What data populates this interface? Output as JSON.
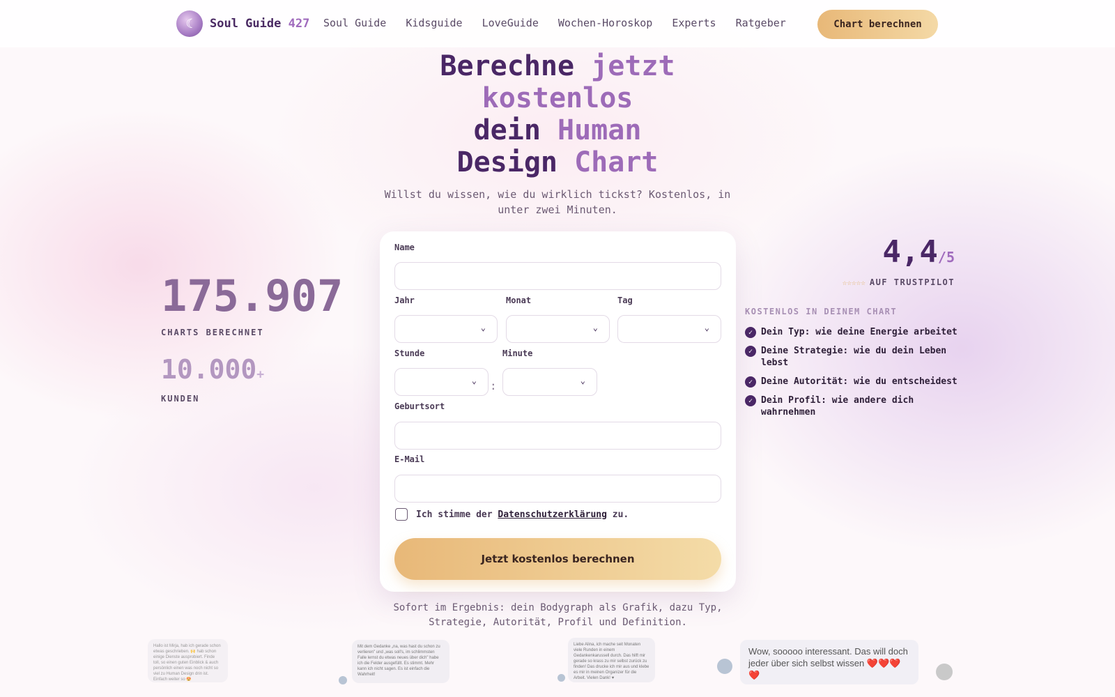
{
  "header": {
    "brand_name": "Soul Guide",
    "brand_number": "427",
    "logo_icon": "moon-face-icon",
    "nav": [
      {
        "label": "Soul Guide"
      },
      {
        "label": "Kidsguide"
      },
      {
        "label": "LoveGuide"
      },
      {
        "label": "Wochen-Horoskop"
      },
      {
        "label": "Experts"
      },
      {
        "label": "Ratgeber"
      }
    ],
    "cta_label": "Chart berechnen"
  },
  "hero": {
    "title_line1_a": "Berechne ",
    "title_line1_b": "jetzt",
    "title_line2": "kostenlos",
    "title_line3_a": "dein ",
    "title_line3_b": "Human",
    "title_line4_a": "Design ",
    "title_line4_b": "Chart",
    "subtitle": "Willst du wissen, wie du wirklich tickst? Kostenlos, in unter zwei Minuten."
  },
  "stats": {
    "charts_value": "175.907",
    "charts_label": "CHARTS BERECHNET",
    "customers_value": "10.000",
    "customers_plus": "+",
    "customers_label": "KUNDEN"
  },
  "rating": {
    "value": "4,4",
    "out_of": "/5",
    "stars": "☆☆☆☆☆",
    "source_label": "AUF TRUSTPILOT"
  },
  "features": {
    "label": "KOSTENLOS IN DEINEM CHART",
    "items": [
      "Dein Typ: wie deine Energie arbeitet",
      "Deine Strategie: wie du dein Leben lebst",
      "Deine Autorität: wie du entscheidest",
      "Dein Profil: wie andere dich wahrnehmen"
    ]
  },
  "form": {
    "name_label": "Name",
    "name_value": "",
    "year_label": "Jahr",
    "month_label": "Monat",
    "day_label": "Tag",
    "hour_label": "Stunde",
    "minute_label": "Minute",
    "time_separator": ":",
    "birthplace_label": "Geburtsort",
    "birthplace_value": "",
    "email_label": "E-Mail",
    "email_value": "",
    "consent_prefix": "Ich stimme der ",
    "consent_link": "Datenschutzerklärung",
    "consent_suffix": " zu.",
    "consent_checked": false,
    "submit_label": "Jetzt kostenlos berechnen"
  },
  "result_note": "Sofort im Ergebnis: dein Bodygraph als Grafik, dazu Typ, Strategie, Autorität, Profil und Definition.",
  "testimonials": [
    {
      "text": "Hallo ist Mirja, hab ich gerade schon etwas geschrieben. 🙌 hab schon einige Dienste ausprobiert. Finde toll, so einen guten Einblick & auch persönlich einen was noch nicht so viel zu Human Design drin ist. Einfach weiter so 😍"
    },
    {
      "text": "Mit dem Gedanke „na, was hast du schon zu verlieren\" und „was soll's, im schlimmsten Falle lernst du etwas neues über dich\" habe ich die Felder ausgefüllt. Es stimmt. Mehr kann ich nicht sagen. Es ist einfach die Wahrheit!"
    },
    {
      "text": "Liebe Alina, ich mache seit Monaten viele Runden in einem Gedankenkarussell durch. Das hilft mir gerade so krass zu mir selbst zurück zu finden! Das drucke ich mir aus und klebe es mir in meinen Organizer für die Arbeit. Vielen Dank! ♥"
    },
    {
      "text": "Wow, sooooo interessant. Das will doch jeder über sich selbst wissen ❤️❤️❤️❤️"
    }
  ]
}
